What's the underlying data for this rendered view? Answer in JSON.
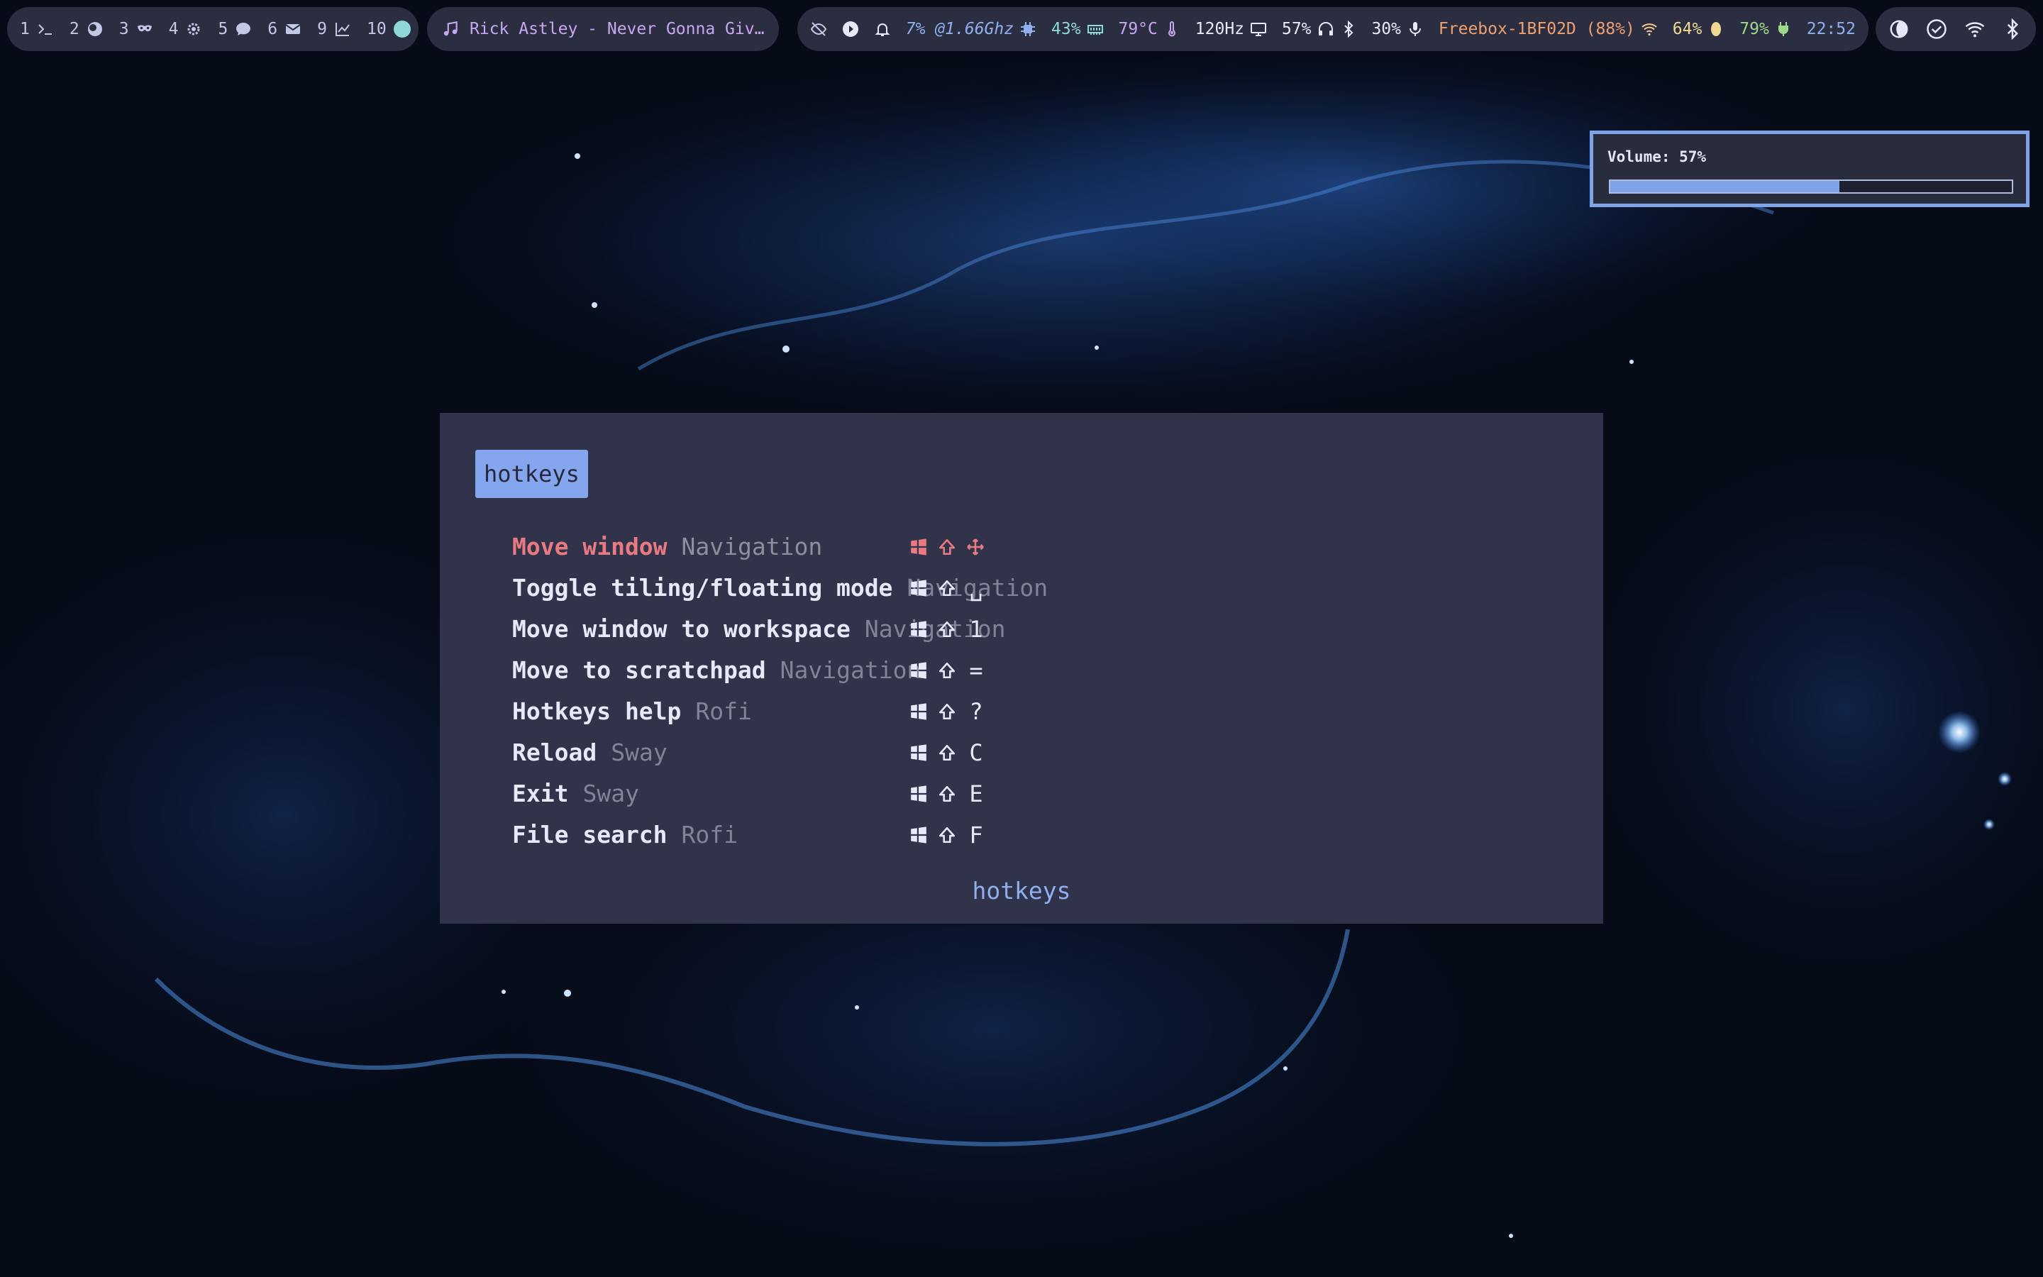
{
  "colors": {
    "bar_bg": "#2b2e40",
    "accent_blue": "#84a6ee",
    "selected_red": "#ea7a82",
    "media_purple": "#c7a7f0",
    "network_orange": "#f0a070",
    "battery_green": "#9fd88a"
  },
  "workspaces": [
    {
      "num": "1",
      "icon": "terminal-icon"
    },
    {
      "num": "2",
      "icon": "browser-icon"
    },
    {
      "num": "3",
      "icon": "mask-icon"
    },
    {
      "num": "4",
      "icon": "gear-icon"
    },
    {
      "num": "5",
      "icon": "chat-icon"
    },
    {
      "num": "6",
      "icon": "mail-icon"
    },
    {
      "num": "9",
      "icon": "chart-icon"
    },
    {
      "num": "10",
      "icon": "dot-icon"
    }
  ],
  "media": {
    "icon": "music-note-icon",
    "text": "Rick Astley - Never Gonna Giv…"
  },
  "status": {
    "cpu": "7% @1.66Ghz",
    "cpu_icon": "cpu-icon",
    "memory": "43%",
    "memory_icon": "memory-icon",
    "temperature": "79°C",
    "temperature_icon": "thermometer-icon",
    "refresh_rate": "120Hz",
    "display_icon": "display-icon",
    "volume": "57%",
    "headphones_icon": "headphones-icon",
    "bluetooth_level": "30%",
    "mic_icon": "mic-icon",
    "network": "Freebox-1BF02D (88%)",
    "wifi_icon": "wifi-icon",
    "brightness": "64%",
    "brightness_icon": "brightness-icon",
    "battery": "79%",
    "battery_icon": "battery-charging-icon",
    "clock": "22:52"
  },
  "tray": [
    "app-tray-icon",
    "check-circle-icon",
    "wifi-icon",
    "bluetooth-icon"
  ],
  "volume_osd": {
    "label": "Volume: 57%",
    "level": 0.57
  },
  "rofi": {
    "prompt": "hotkeys",
    "footer": "hotkeys",
    "selected_index": 0,
    "entries": [
      {
        "name": "Move window",
        "category": "Navigation",
        "keys": [
          "windows-key-icon",
          "shift-icon",
          "move-arrows-icon"
        ]
      },
      {
        "name": "Toggle tiling/floating mode",
        "category": "Navigation",
        "keys": [
          "windows-key-icon",
          "shift-icon",
          "␣"
        ]
      },
      {
        "name": "Move window to workspace",
        "category": "Navigation",
        "keys": [
          "windows-key-icon",
          "shift-icon",
          "1"
        ]
      },
      {
        "name": "Move to scratchpad",
        "category": "Navigation",
        "keys": [
          "windows-key-icon",
          "shift-icon",
          "="
        ]
      },
      {
        "name": "Hotkeys help",
        "category": "Rofi",
        "keys": [
          "windows-key-icon",
          "shift-icon",
          "?"
        ]
      },
      {
        "name": "Reload",
        "category": "Sway",
        "keys": [
          "windows-key-icon",
          "shift-icon",
          "C"
        ]
      },
      {
        "name": "Exit",
        "category": "Sway",
        "keys": [
          "windows-key-icon",
          "shift-icon",
          "E"
        ]
      },
      {
        "name": "File search",
        "category": "Rofi",
        "keys": [
          "windows-key-icon",
          "shift-icon",
          "F"
        ]
      }
    ]
  }
}
